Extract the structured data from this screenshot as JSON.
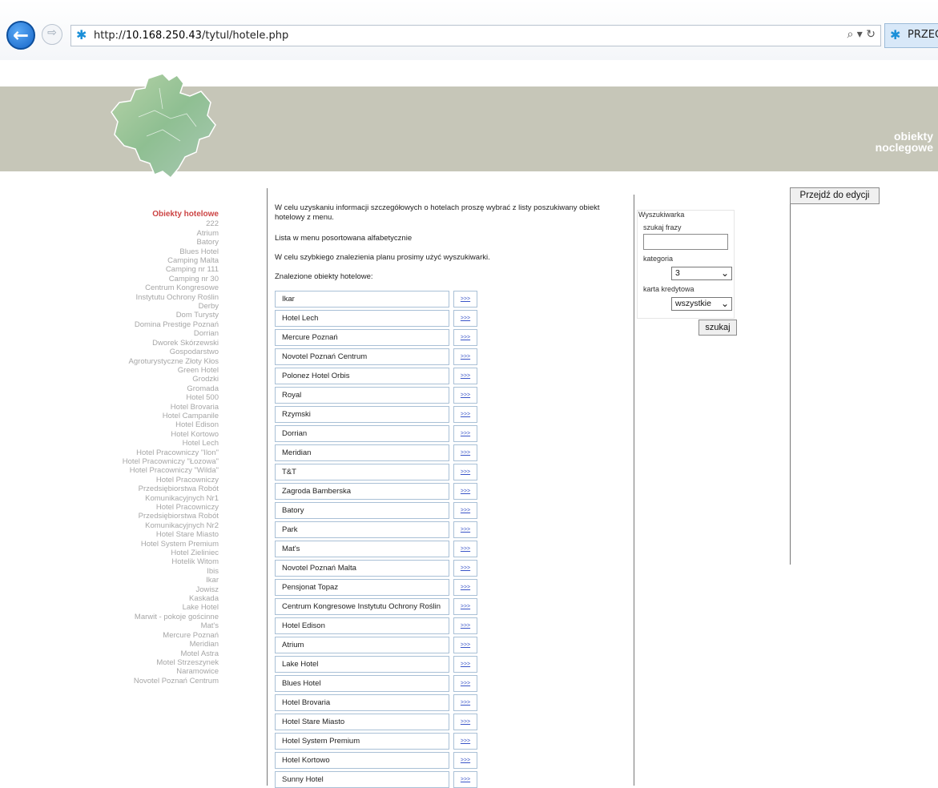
{
  "browser": {
    "url_prefix": "http://",
    "url_host": "10.168.250.43",
    "url_path": "/tytul/hotele.php",
    "tab_label": "PRZEG",
    "addr_tools": "⌕ ▾ ↻",
    "star_glyph": "✱",
    "accent": "#1a8fd8"
  },
  "banner": {
    "line1": "obiekty",
    "line2": "noclegowe",
    "band_color": "#c6c6b8"
  },
  "left_nav": {
    "title": "Obiekty hotelowe",
    "items": [
      "222",
      "Atrium",
      "Batory",
      "Blues Hotel",
      "Camping Malta",
      "Camping nr 111",
      "Camping nr 30",
      "Centrum Kongresowe",
      "Instytutu Ochrony Roślin",
      "Derby",
      "Dom Turysty",
      "Domina Prestige Poznań",
      "Dorrian",
      "Dworek Skórzewski",
      "Gospodarstwo",
      "Agroturystyczne Złoty Kłos",
      "Green Hotel",
      "Grodzki",
      "Gromada",
      "Hotel 500",
      "Hotel Brovaria",
      "Hotel Campanile",
      "Hotel Edison",
      "Hotel Kortowo",
      "Hotel Lech",
      "Hotel Pracowniczy \"Ilon\"",
      "Hotel Pracowniczy \"Łozowa\"",
      "Hotel Pracowniczy \"Wilda\"",
      "Hotel Pracowniczy",
      "Przedsiębiorstwa Robót",
      "Komunikacyjnych Nr1",
      "Hotel Pracowniczy",
      "Przedsiębiorstwa Robót",
      "Komunikacyjnych Nr2",
      "Hotel Stare Miasto",
      "Hotel System Premium",
      "Hotel Zieliniec",
      "Hotelik Witom",
      "Ibis",
      "Ikar",
      "Jowisz",
      "Kaskada",
      "Lake Hotel",
      "Marwit - pokoje gościnne",
      "Mat's",
      "Mercure Poznań",
      "Meridian",
      "Motel Astra",
      "Motel Strzeszynek",
      "Naramowice",
      "Novotel Poznań Centrum"
    ]
  },
  "intro": {
    "p1": "W celu uzyskaniu informacji szczegółowych o hotelach proszę wybrać z listy poszukiwany obiekt hotelowy z menu.",
    "p2": "Lista w menu posortowana alfabetycznie",
    "p3": "W celu szybkiego znalezienia planu prosimy użyć wyszukiwarki.",
    "p4": "Znalezione obiekty hotelowe:"
  },
  "results": {
    "go_label": ">>>",
    "items": [
      "Ikar",
      "Hotel Lech",
      "Mercure Poznań",
      "Novotel Poznań Centrum",
      "Polonez Hotel Orbis",
      "Royal",
      "Rzymski",
      "Dorrian",
      "Meridian",
      "T&T",
      "Zagroda Bamberska",
      "Batory",
      "Park",
      "Mat's",
      "Novotel Poznań Malta",
      "Pensjonat Topaz",
      "Centrum Kongresowe Instytutu Ochrony Roślin",
      "Hotel Edison",
      "Atrium",
      "Lake Hotel",
      "Blues Hotel",
      "Hotel Brovaria",
      "Hotel Stare Miasto",
      "Hotel System Premium",
      "Hotel Kortowo",
      "Sunny Hotel"
    ]
  },
  "search": {
    "legend": "Wyszukiwarka",
    "phrase_label": "szukaj frazy",
    "phrase_value": "",
    "category_label": "kategoria",
    "category_value": "3",
    "card_label": "karta kredytowa",
    "card_value": "wszystkie",
    "submit_label": "szukaj",
    "chevron": "⌄"
  },
  "edit_button": "Przejdź do edycji"
}
